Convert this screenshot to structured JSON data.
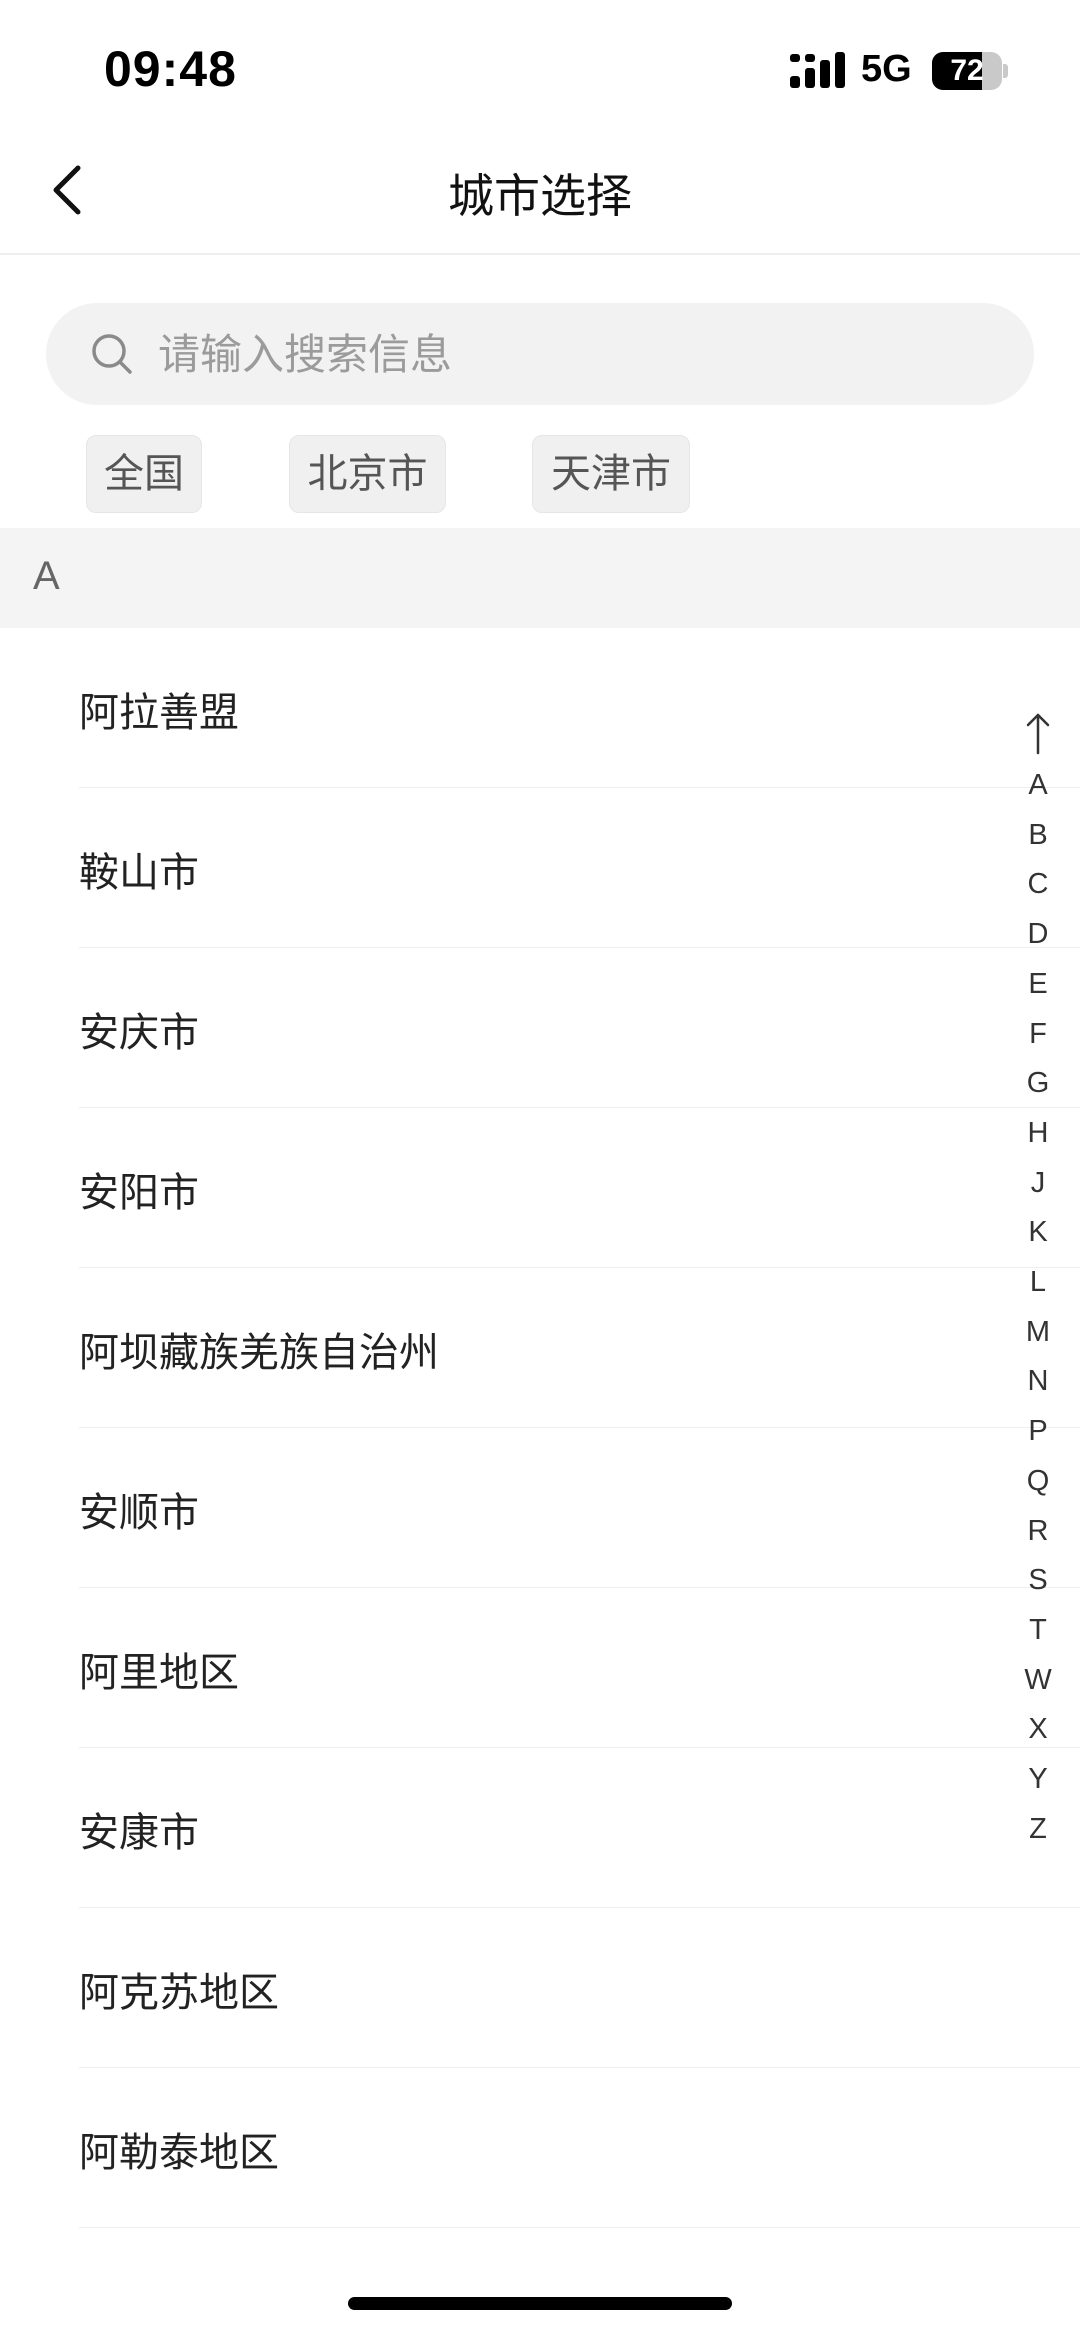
{
  "status_bar": {
    "time": "09:48",
    "network": "5G",
    "battery_level": "72",
    "battery_percent": 72
  },
  "nav": {
    "title": "城市选择",
    "back_icon": "chevron-left-icon"
  },
  "search": {
    "placeholder": "请输入搜索信息",
    "value": "",
    "icon": "search-icon"
  },
  "quick_cities": [
    "全国",
    "北京市",
    "天津市"
  ],
  "section": {
    "letter": "A",
    "cities": [
      "阿拉善盟",
      "鞍山市",
      "安庆市",
      "安阳市",
      "阿坝藏族羌族自治州",
      "安顺市",
      "阿里地区",
      "安康市",
      "阿克苏地区",
      "阿勒泰地区"
    ]
  },
  "index_bar": {
    "top_icon": "arrow-up-icon",
    "letters": [
      "A",
      "B",
      "C",
      "D",
      "E",
      "F",
      "G",
      "H",
      "J",
      "K",
      "L",
      "M",
      "N",
      "P",
      "Q",
      "R",
      "S",
      "T",
      "W",
      "X",
      "Y",
      "Z"
    ]
  }
}
